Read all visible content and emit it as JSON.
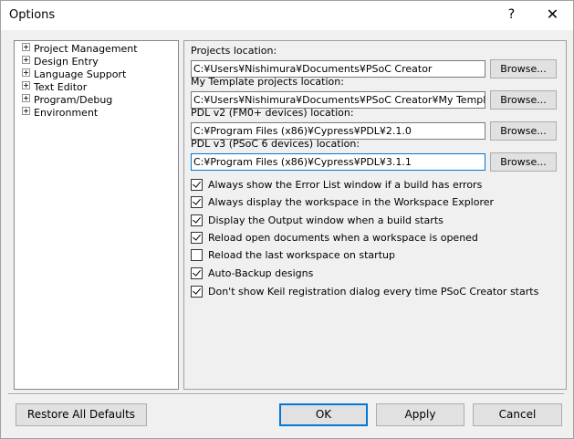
{
  "window": {
    "title": "Options",
    "help_glyph": "?",
    "close_glyph": "✕"
  },
  "tree": {
    "items": [
      {
        "label": "Project Management"
      },
      {
        "label": "Design Entry"
      },
      {
        "label": "Language Support"
      },
      {
        "label": "Text Editor"
      },
      {
        "label": "Program/Debug"
      },
      {
        "label": "Environment"
      }
    ]
  },
  "locations": [
    {
      "label": "Projects location:",
      "value": "C:¥Users¥Nishimura¥Documents¥PSoC Creator",
      "button": "Browse..."
    },
    {
      "label": "My Template projects location:",
      "value": "C:¥Users¥Nishimura¥Documents¥PSoC Creator¥My Templates",
      "button": "Browse..."
    },
    {
      "label": "PDL v2 (FM0+ devices) location:",
      "value": "C:¥Program Files (x86)¥Cypress¥PDL¥2.1.0",
      "button": "Browse..."
    },
    {
      "label": "PDL v3 (PSoC 6 devices) location:",
      "value": "C:¥Program Files (x86)¥Cypress¥PDL¥3.1.1",
      "button": "Browse..."
    }
  ],
  "checkboxes": [
    {
      "label": "Always show the Error List window if a build has errors",
      "checked": true
    },
    {
      "label": "Always display the workspace in the Workspace Explorer",
      "checked": true
    },
    {
      "label": "Display the Output window when a build starts",
      "checked": true
    },
    {
      "label": "Reload open documents when a workspace is opened",
      "checked": true
    },
    {
      "label": "Reload the last workspace on startup",
      "checked": false
    },
    {
      "label": "Auto-Backup designs",
      "checked": true
    },
    {
      "label": "Don't show Keil registration dialog every time PSoC Creator starts",
      "checked": true
    }
  ],
  "buttons": {
    "restore": "Restore All Defaults",
    "ok": "OK",
    "apply": "Apply",
    "cancel": "Cancel"
  }
}
